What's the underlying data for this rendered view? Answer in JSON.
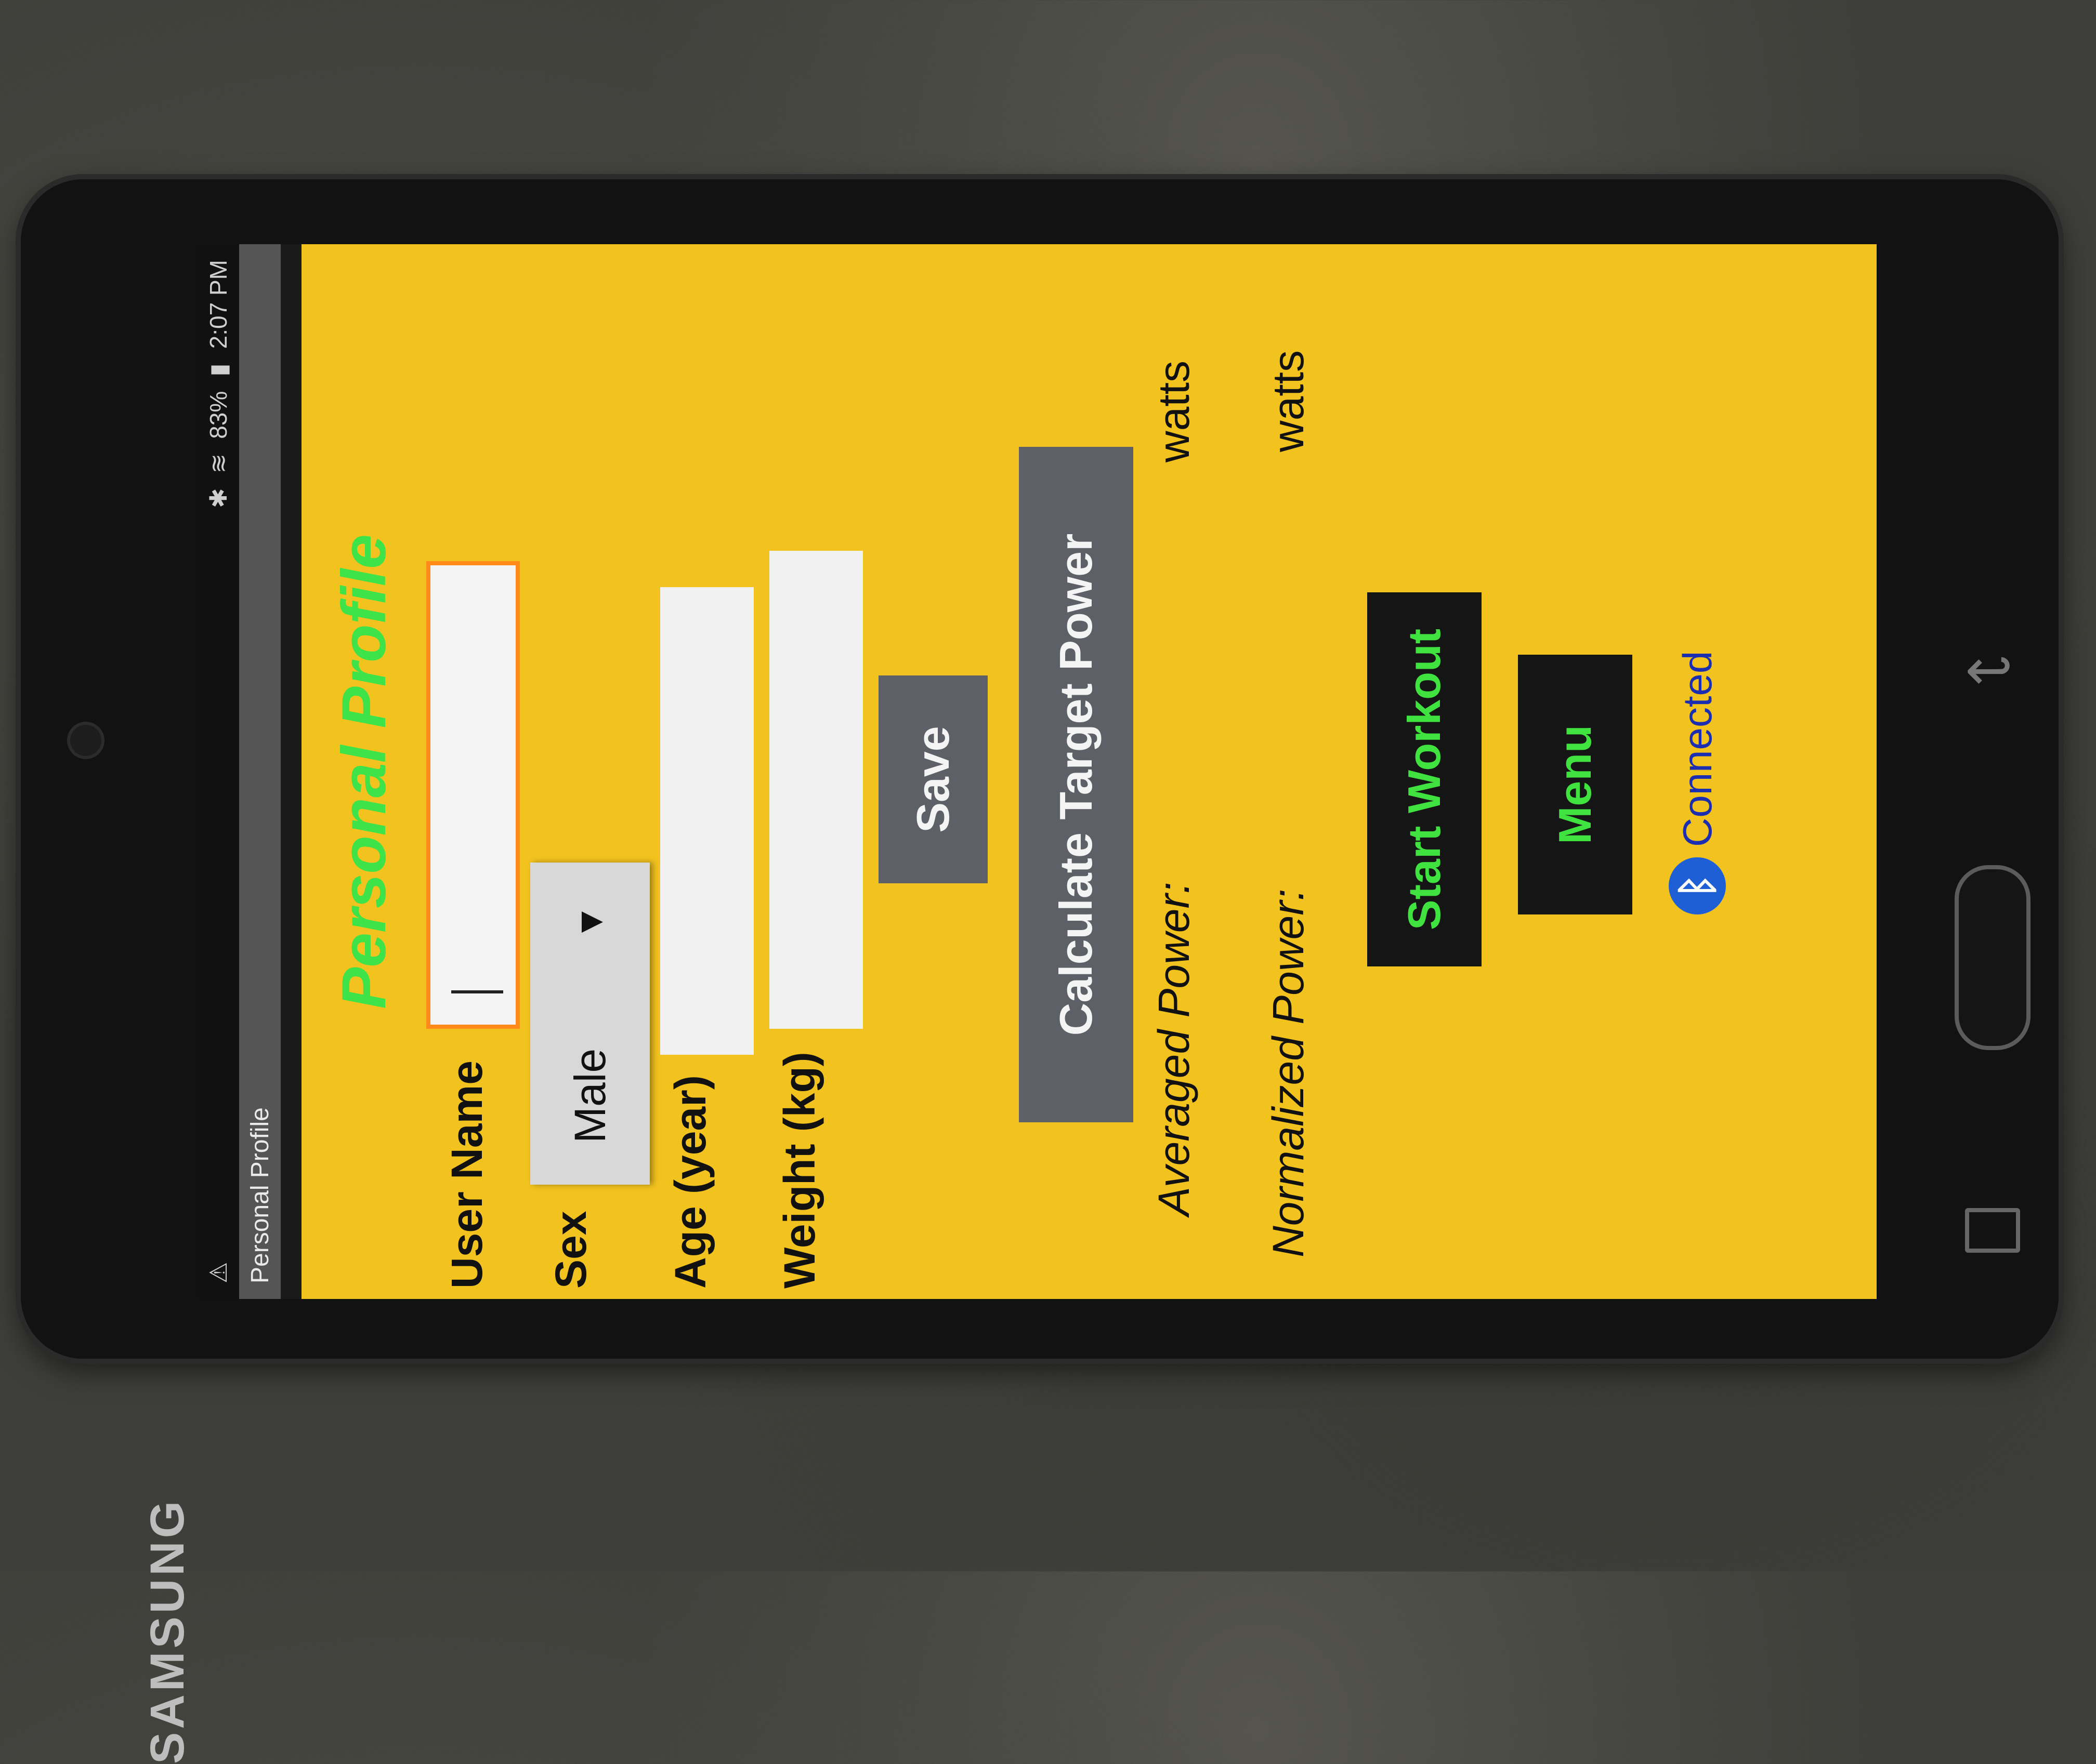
{
  "device": {
    "brand": "SAMSUNG"
  },
  "statusbar": {
    "battery": "83%",
    "time": "2:07 PM",
    "warning_icon": "warning-icon"
  },
  "actionbar": {
    "title": "Personal Profile"
  },
  "app": {
    "heading": "Personal Profile",
    "fields": {
      "username_label": "User Name",
      "username_value": "",
      "sex_label": "Sex",
      "sex_value": "Male",
      "age_label": "Age (year)",
      "age_value": "",
      "weight_label": "Weight (kg)",
      "weight_value": ""
    },
    "buttons": {
      "save": "Save",
      "calculate": "Calculate Target Power",
      "start": "Start Workout",
      "menu": "Menu"
    },
    "power": {
      "averaged_label": "Averaged Power:",
      "averaged_unit": "watts",
      "normalized_label": "Normalized Power:",
      "normalized_unit": "watts"
    },
    "bluetooth": {
      "status": "Connected"
    }
  },
  "colors": {
    "background": "#f2c21e",
    "heading": "#3ee34a",
    "button_gray": "#5d6066",
    "button_dark": "#151515",
    "accent_focus": "#ff8a1a"
  }
}
